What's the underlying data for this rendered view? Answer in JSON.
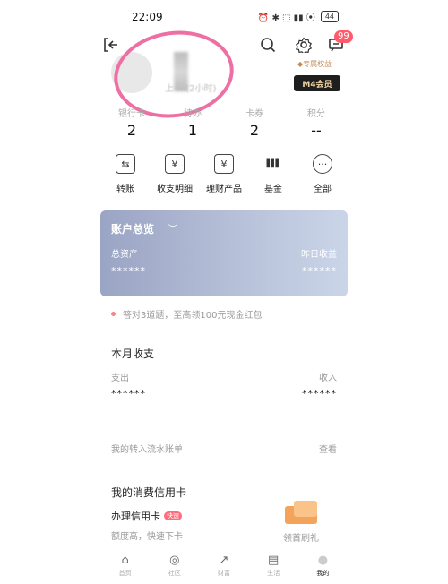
{
  "status_bar": {
    "time": "22:09",
    "icons": "⏰ ✱ ⬚ ▮▮ ⦿",
    "battery": "44"
  },
  "header": {
    "notifications_badge": "99"
  },
  "profile": {
    "name_blurred": "",
    "subtitle_blurred": "上 …(2小时)",
    "vip_tag": "◆专属权益",
    "member_label": "M4会员"
  },
  "stats": [
    {
      "label": "银行卡",
      "value": "2"
    },
    {
      "label": "待办",
      "value": "1"
    },
    {
      "label": "卡券",
      "value": "2"
    },
    {
      "label": "积分",
      "value": "--"
    }
  ],
  "menu": [
    {
      "label": "转账",
      "icon": "transfer-icon",
      "glyph": "⇆"
    },
    {
      "label": "收支明细",
      "icon": "receipt-icon",
      "glyph": "¥"
    },
    {
      "label": "理财产品",
      "icon": "finance-icon",
      "glyph": "¥"
    },
    {
      "label": "基金",
      "icon": "bar-chart-icon",
      "glyph": "▌▌▌"
    },
    {
      "label": "全部",
      "icon": "more-icon",
      "glyph": "···"
    }
  ],
  "overview": {
    "title": "账户总览",
    "total_label": "总资产",
    "total_value": "******",
    "yday_label": "昨日收益",
    "yday_value": "******"
  },
  "promo": {
    "text": "答对3道题，至高领100元现金红包"
  },
  "monthly": {
    "title": "本月收支",
    "out_label": "支出",
    "out_value": "******",
    "in_label": "收入",
    "in_value": "******"
  },
  "transfer_bill": {
    "label": "我的转入流水账单",
    "action": "查看"
  },
  "credit": {
    "title": "我的消费信用卡",
    "apply": "办理信用卡",
    "tag": "快速",
    "desc": "额度高，快速下卡",
    "gift": "领首刷礼"
  },
  "tabs": [
    {
      "label": "首页",
      "icon": "home-icon",
      "glyph": "⌂"
    },
    {
      "label": "社区",
      "icon": "community-icon",
      "glyph": "◎"
    },
    {
      "label": "财富",
      "icon": "wealth-icon",
      "glyph": "↗"
    },
    {
      "label": "生活",
      "icon": "life-icon",
      "glyph": "▤"
    },
    {
      "label": "我的",
      "icon": "profile-icon",
      "glyph": "●"
    }
  ],
  "colors": {
    "card_start": "#9aa4c4",
    "card_end": "#cad5e8",
    "badge": "#ff5b6b",
    "annotation": "#ee6fa3"
  }
}
